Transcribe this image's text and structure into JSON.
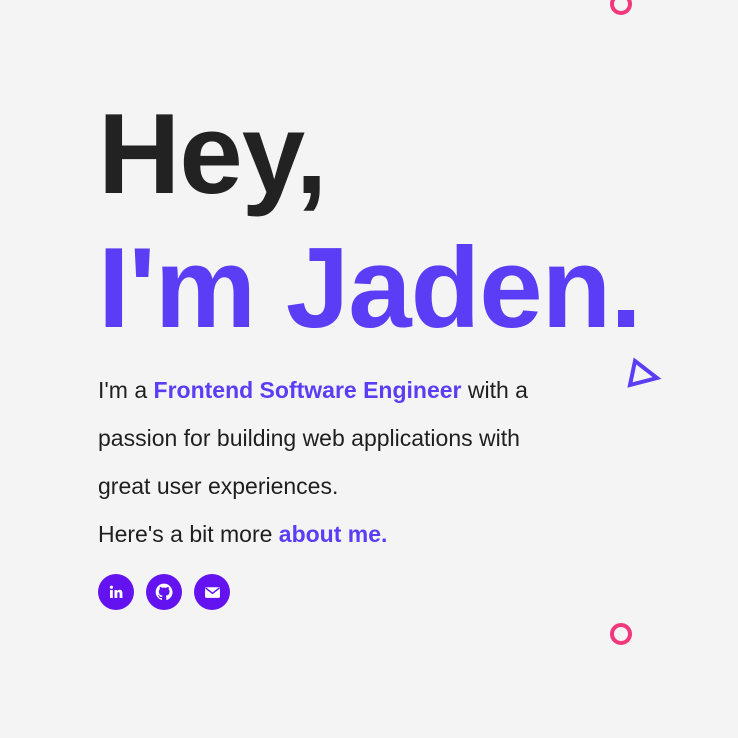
{
  "hero": {
    "line1": "Hey,",
    "line2": "I'm Jaden."
  },
  "intro": {
    "prefix": "I'm a ",
    "role": "Frontend Software Engineer",
    "suffix": " with a passion for building web applications with great user experiences.",
    "more_prefix": "Here's a bit more ",
    "about_link": "about me."
  },
  "socials": [
    {
      "name": "linkedin-icon"
    },
    {
      "name": "github-icon"
    },
    {
      "name": "email-icon"
    }
  ],
  "colors": {
    "accent": "#5b3df5",
    "social_bg": "#6312f0",
    "decor_pink": "#f2387d",
    "background": "#f4f4f4",
    "text": "#222222"
  }
}
